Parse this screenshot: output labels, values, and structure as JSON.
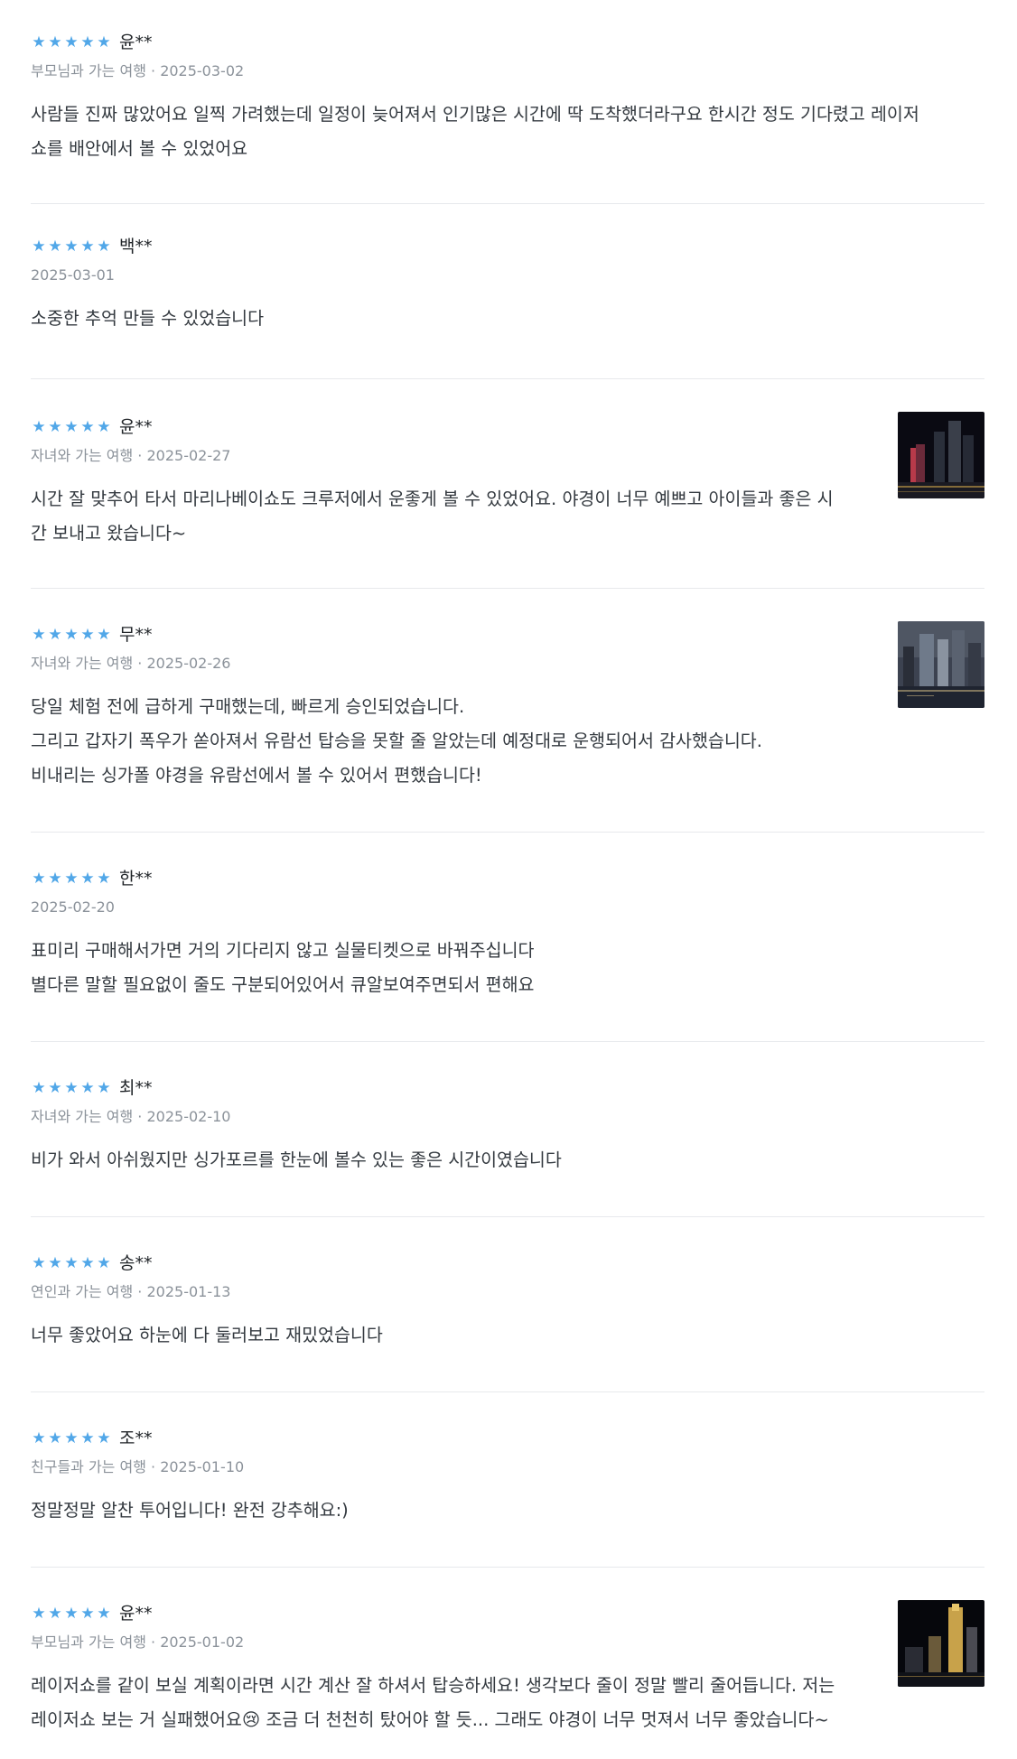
{
  "reviews": [
    {
      "rating": 5,
      "name": "윤**",
      "meta": "부모님과 가는 여행 · 2025-03-02",
      "text": "사람들 진짜 많았어요 일찍 가려했는데 일정이 늦어져서 인기많은 시간에 딱 도착했더라구요 한시간 정도 기다렸고 레이저\n쇼를 배안에서 볼 수 있었어요",
      "photo": false
    },
    {
      "rating": 5,
      "name": "백**",
      "meta": "2025-03-01",
      "text": "소중한 추억 만들 수 있었습니다",
      "photo": false
    },
    {
      "rating": 5,
      "name": "윤**",
      "meta": "자녀와 가는 여행 · 2025-02-27",
      "text": "시간 잘 맞추어 타서 마리나베이쇼도 크루저에서 운좋게 볼 수 있었어요. 야경이 너무 예쁘고 아이들과 좋은 시\n간 보내고 왔습니다~",
      "photo": true,
      "photo_desc": "night-skyline-photo"
    },
    {
      "rating": 5,
      "name": "무**",
      "meta": "자녀와 가는 여행 · 2025-02-26",
      "text": "당일 체험 전에 급하게 구매했는데, 빠르게 승인되었습니다.\n그리고 갑자기 폭우가 쏟아져서 유람선 탑승을 못할 줄 알았는데 예정대로 운행되어서 감사했습니다.\n비내리는 싱가폴 야경을 유람선에서 볼 수 있어서 편했습니다!",
      "photo": true,
      "photo_desc": "rainy-skyline-photo"
    },
    {
      "rating": 5,
      "name": "한**",
      "meta": "2025-02-20",
      "text": "표미리 구매해서가면 거의 기다리지 않고 실물티켓으로 바꿔주십니다\n별다른 말할 필요없이 줄도 구분되어있어서 큐알보여주면되서 편해요",
      "photo": false
    },
    {
      "rating": 5,
      "name": "최**",
      "meta": "자녀와 가는 여행 · 2025-02-10",
      "text": "비가 와서 아쉬웠지만 싱가포르를 한눈에 볼수 있는 좋은 시간이였습니다",
      "photo": false
    },
    {
      "rating": 5,
      "name": "송**",
      "meta": "연인과 가는 여행 · 2025-01-13",
      "text": "너무 좋았어요 하눈에 다 둘러보고 재밌었습니다",
      "photo": false
    },
    {
      "rating": 5,
      "name": "조**",
      "meta": "친구들과 가는 여행 · 2025-01-10",
      "text": "정말정말 알찬 투어입니다! 완전 강추해요:)",
      "photo": false
    },
    {
      "rating": 5,
      "name": "윤**",
      "meta": "부모님과 가는 여행 · 2025-01-02",
      "text": "레이저쇼를 같이 보실 계획이라면 시간 계산 잘 하셔서 탑승하세요! 생각보다 줄이 정말 빨리 줄어듭니다. 저는\n레이저쇼 보는 거 실패했어요😢 조금 더 천천히 탔어야 할 듯... 그래도 야경이 너무 멋져서 너무 좋았습니다~",
      "photo": true,
      "photo_desc": "night-tower-photo"
    }
  ],
  "star_glyph": "★",
  "star_color": "#51a7e8"
}
